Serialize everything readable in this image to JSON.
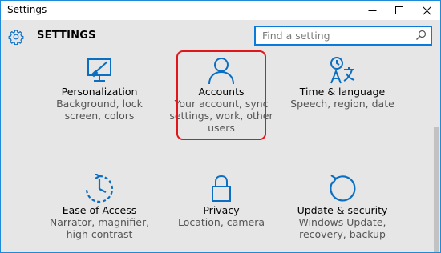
{
  "window": {
    "title": "Settings"
  },
  "header": {
    "title": "SETTINGS"
  },
  "search": {
    "placeholder": "Find a setting"
  },
  "tiles": [
    {
      "name": "Personalization",
      "desc": [
        "Background, lock",
        "screen, colors"
      ],
      "icon": "personalization-icon"
    },
    {
      "name": "Accounts",
      "desc": [
        "Your account, sync",
        "settings, work, other",
        "users"
      ],
      "icon": "account-icon"
    },
    {
      "name": "Time & language",
      "desc": [
        "Speech, region, date"
      ],
      "icon": "time-language-icon"
    },
    {
      "name": "Ease of Access",
      "desc": [
        "Narrator, magnifier,",
        "high contrast"
      ],
      "icon": "ease-of-access-icon"
    },
    {
      "name": "Privacy",
      "desc": [
        "Location, camera"
      ],
      "icon": "lock-icon"
    },
    {
      "name": "Update & security",
      "desc": [
        "Windows Update,",
        "recovery, backup"
      ],
      "icon": "refresh-icon"
    }
  ],
  "colors": {
    "accent": "#0a7bd8",
    "highlight": "#e0161a",
    "background": "#e6e6e6"
  }
}
